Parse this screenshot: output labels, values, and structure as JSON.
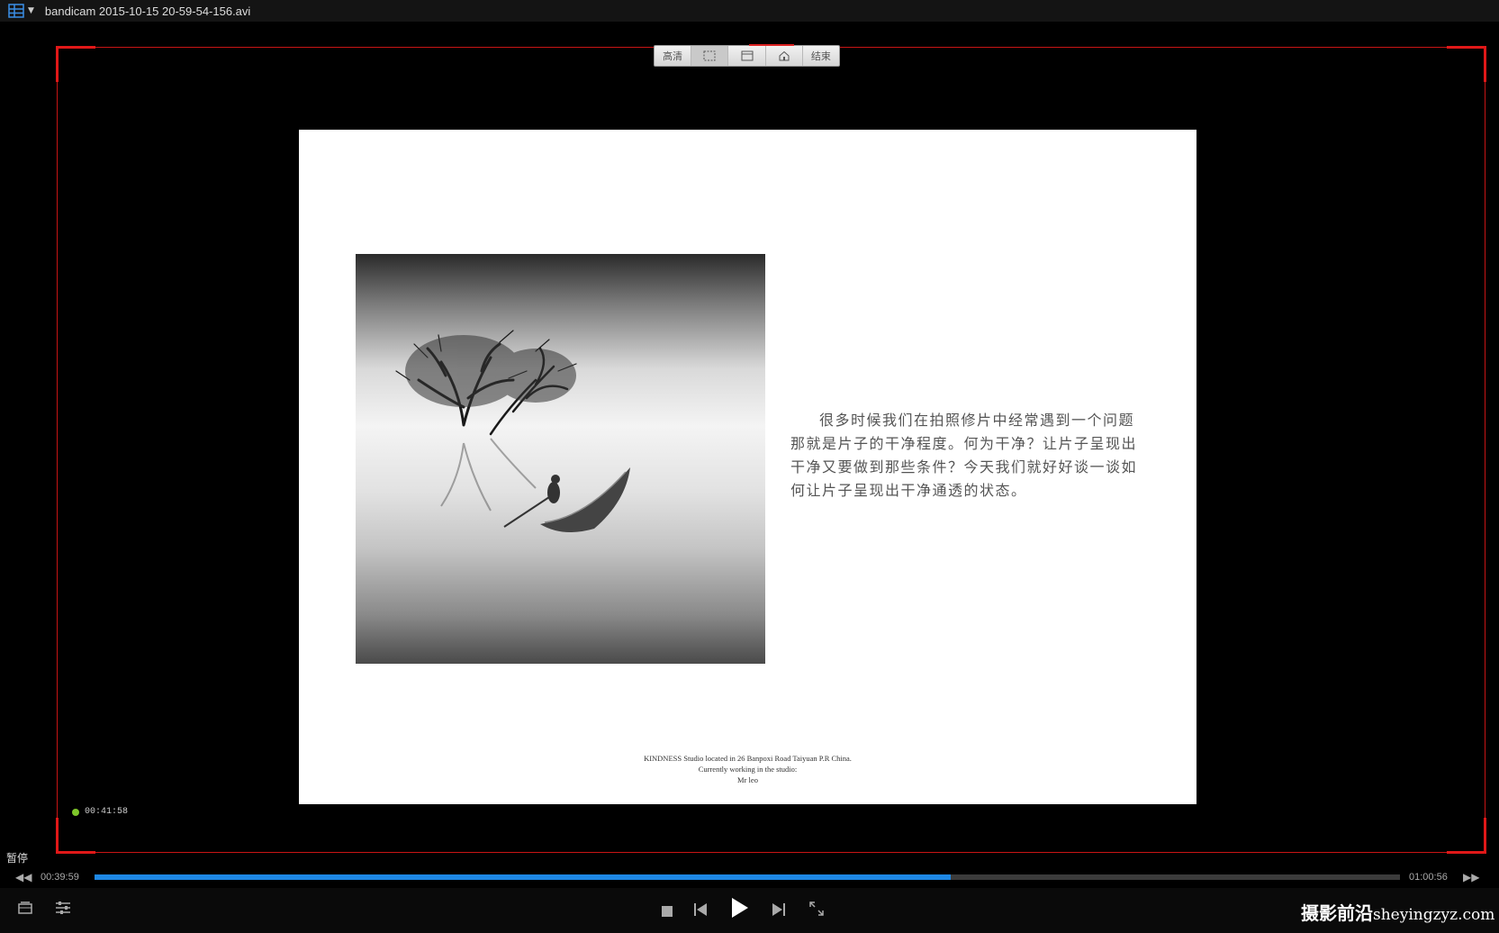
{
  "titlebar": {
    "title": "bandicam 2015-10-15 20-59-54-156.avi"
  },
  "toolbar": {
    "items": [
      "高清",
      "",
      "",
      "",
      "结束"
    ]
  },
  "slide": {
    "paragraph": "很多时候我们在拍照修片中经常遇到一个问题那就是片子的干净程度。何为干净？让片子呈现出干净又要做到那些条件？今天我们就好好谈一谈如何让片子呈现出干净通透的状态。",
    "footer": [
      "KINDNESS Studio located in 26 Banpoxi Road Taiyuan P.R China.",
      "Currently working in the studio:",
      "Mr leo"
    ]
  },
  "recording": {
    "time": "00:41:58",
    "color": "#7ec62a"
  },
  "player": {
    "status": "暂停",
    "current_time": "00:39:59",
    "duration": "01:00:56",
    "progress": 0.656,
    "accent": "#1e88e5"
  },
  "watermark": {
    "cn": "摄影前沿",
    "url": "sheyingzyz.com"
  },
  "icons": {
    "menu": "layout-grid-icon",
    "stop": "stop-icon",
    "prev": "previous-icon",
    "play": "play-icon",
    "next": "next-icon",
    "fullscreen": "fullscreen-icon",
    "playlist": "playlist-icon",
    "settings": "settings-icon"
  }
}
